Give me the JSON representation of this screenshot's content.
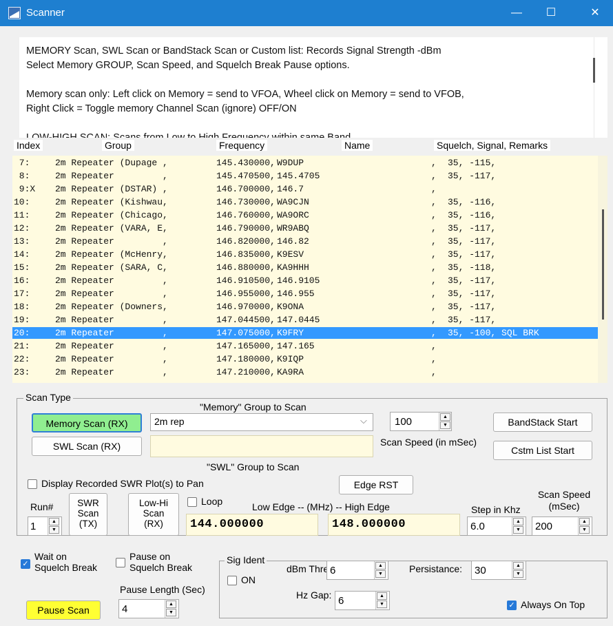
{
  "window": {
    "title": "Scanner",
    "controls": [
      "—",
      "☐",
      "✕"
    ]
  },
  "info_text": [
    "MEMORY Scan, SWL Scan or BandStack Scan or Custom list:  Records Signal Strength -dBm",
    "Select Memory GROUP, Scan Speed, and Squelch Break Pause options.",
    "",
    "Memory scan only: Left click on Memory = send to VFOA, Wheel click on Memory = send to VFOB,",
    "Right Click = Toggle memory Channel Scan (ignore) OFF/ON",
    "",
    "LOW-HIGH SCAN: Scans from Low to High Frequency within same Band"
  ],
  "columns": {
    "index": "Index",
    "group": "Group",
    "frequency": "Frequency",
    "name": "Name",
    "remarks": "Squelch, Signal, Remarks"
  },
  "rows": [
    {
      "idx": " 7:",
      "group": "2m Repeater (Dupage ,",
      "freq": "145.430000,",
      "name": "W9DUP",
      "sep": ",",
      "rem": "35, -115,",
      "selected": false
    },
    {
      "idx": " 8:",
      "group": "2m Repeater         ,",
      "freq": "145.470500,",
      "name": "145.4705",
      "sep": ",",
      "rem": "35, -117,",
      "selected": false
    },
    {
      "idx": " 9:X",
      "group": "2m Repeater (DSTAR) ,",
      "freq": "146.700000,",
      "name": "146.7",
      "sep": ",",
      "rem": "",
      "selected": false
    },
    {
      "idx": "10:",
      "group": "2m Repeater (Kishwau,",
      "freq": "146.730000,",
      "name": "WA9CJN",
      "sep": ",",
      "rem": "35, -116,",
      "selected": false
    },
    {
      "idx": "11:",
      "group": "2m Repeater (Chicago,",
      "freq": "146.760000,",
      "name": "WA9ORC",
      "sep": ",",
      "rem": "35, -116,",
      "selected": false
    },
    {
      "idx": "12:",
      "group": "2m Repeater (VARA, E,",
      "freq": "146.790000,",
      "name": "WR9ABQ",
      "sep": ",",
      "rem": "35, -117,",
      "selected": false
    },
    {
      "idx": "13:",
      "group": "2m Repeater         ,",
      "freq": "146.820000,",
      "name": "146.82",
      "sep": ",",
      "rem": "35, -117,",
      "selected": false
    },
    {
      "idx": "14:",
      "group": "2m Repeater (McHenry,",
      "freq": "146.835000,",
      "name": "K9ESV",
      "sep": ",",
      "rem": "35, -117,",
      "selected": false
    },
    {
      "idx": "15:",
      "group": "2m Repeater (SARA, C,",
      "freq": "146.880000,",
      "name": "KA9HHH",
      "sep": ",",
      "rem": "35, -118,",
      "selected": false
    },
    {
      "idx": "16:",
      "group": "2m Repeater         ,",
      "freq": "146.910500,",
      "name": "146.9105",
      "sep": ",",
      "rem": "35, -117,",
      "selected": false
    },
    {
      "idx": "17:",
      "group": "2m Repeater         ,",
      "freq": "146.955000,",
      "name": "146.955",
      "sep": ",",
      "rem": "35, -117,",
      "selected": false
    },
    {
      "idx": "18:",
      "group": "2m Repeater (Downers,",
      "freq": "146.970000,",
      "name": "K9ONA",
      "sep": ",",
      "rem": "35, -117,",
      "selected": false
    },
    {
      "idx": "19:",
      "group": "2m Repeater         ,",
      "freq": "147.044500,",
      "name": "147.0445",
      "sep": ",",
      "rem": "35, -117,",
      "selected": false
    },
    {
      "idx": "20:",
      "group": "2m Repeater         ,",
      "freq": "147.075000,",
      "name": "K9FRY",
      "sep": ",",
      "rem": "35, -100, SQL BRK",
      "selected": true
    },
    {
      "idx": "21:",
      "group": "2m Repeater         ,",
      "freq": "147.165000,",
      "name": "147.165",
      "sep": ",",
      "rem": "",
      "selected": false
    },
    {
      "idx": "22:",
      "group": "2m Repeater         ,",
      "freq": "147.180000,",
      "name": "K9IQP",
      "sep": ",",
      "rem": "",
      "selected": false
    },
    {
      "idx": "23:",
      "group": "2m Repeater         ,",
      "freq": "147.210000,",
      "name": "KA9RA",
      "sep": ",",
      "rem": "",
      "selected": false
    }
  ],
  "scan_type": {
    "label": "Scan Type",
    "memory_group_label": "\"Memory\" Group to Scan",
    "memory_scan_button": "Memory Scan (RX)",
    "memory_group_value": "2m rep",
    "scan_speed_value": "100",
    "scan_speed_label": "Scan Speed (in mSec)",
    "bandstack_start_button": "BandStack Start",
    "cstm_list_start_button": "Cstm List Start",
    "swl_scan_button": "SWL Scan (RX)",
    "swl_group_value": "",
    "swl_group_label": "\"SWL\" Group to Scan",
    "display_swr_label": "Display Recorded SWR Plot(s) to Pan",
    "edge_rst_button": "Edge RST",
    "run_label": "Run#",
    "run_value": "1",
    "swr_scan_button": "SWR\nScan\n(TX)",
    "lowhi_scan_button": "Low-Hi\nScan\n(RX)",
    "loop_label": "Loop",
    "edge_label": "Low Edge --  (MHz)  --  High Edge",
    "low_edge_value": "144.000000",
    "high_edge_value": "148.000000",
    "step_label": "Step in Khz",
    "step_value": "6.0",
    "scan_speed2_label": "Scan Speed\n(mSec)",
    "scan_speed2_value": "200"
  },
  "bottom": {
    "wait_squelch_label": "Wait on\nSquelch Break",
    "wait_squelch_checked": true,
    "pause_squelch_label": "Pause on\nSquelch Break",
    "pause_squelch_checked": false,
    "pause_length_label": "Pause Length (Sec)",
    "pause_length_value": "4",
    "pause_scan_button": "Pause Scan",
    "sig_ident_label": "Sig Ident",
    "on_label": "ON",
    "dbm_thres_label": "dBm Thres:",
    "dbm_thres_value": "6",
    "persistance_label": "Persistance:",
    "persistance_value": "30",
    "hz_gap_label": "Hz Gap:",
    "hz_gap_value": "6",
    "always_on_top_label": "Always On Top",
    "always_on_top_checked": true
  },
  "colors": {
    "titlebar": "#1e7fd0",
    "list_bg": "#fffbe0",
    "selected_row": "#3399ff",
    "memory_button": "#90ee90",
    "pause_button": "#ffff33"
  }
}
